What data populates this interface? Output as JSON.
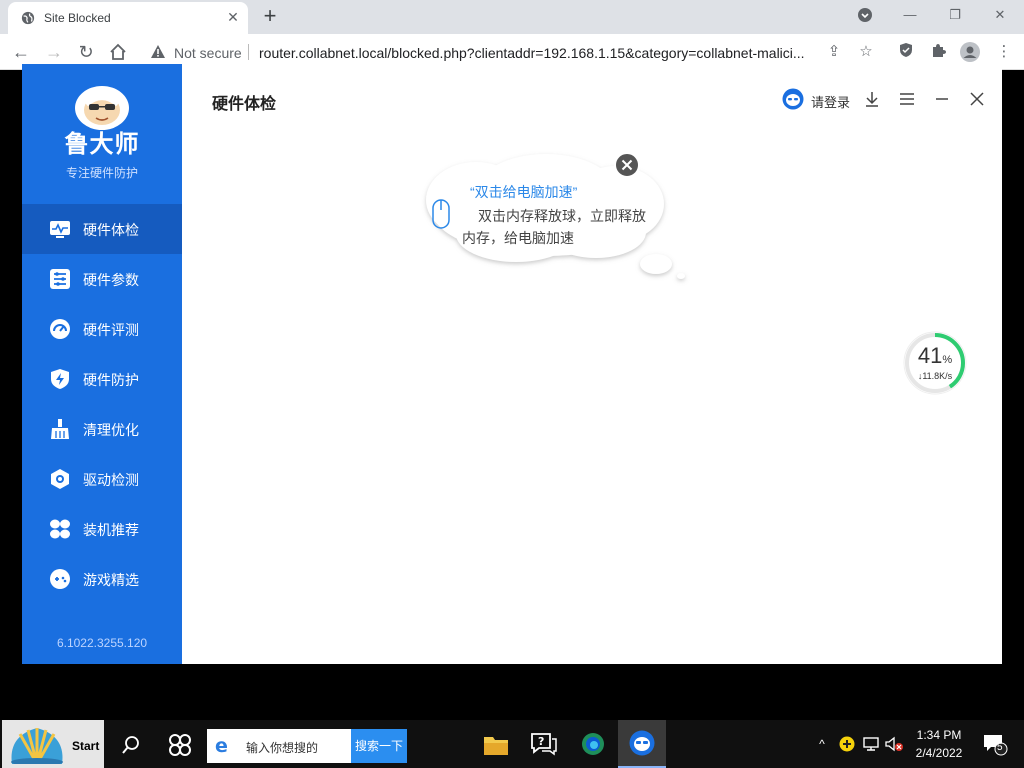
{
  "browser": {
    "tab_title": "Site Blocked",
    "new_tab": "+",
    "security_label": "Not secure",
    "url": "router.collabnet.local/blocked.php?clientaddr=192.168.1.15&category=collabnet-malici..."
  },
  "app": {
    "brand": "鲁大师",
    "slogan": "专注硬件防护",
    "content_title": "硬件体检",
    "login_label": "请登录",
    "version": "6.1022.3255.120",
    "accent_color": "#1a6fe0",
    "menu": [
      {
        "label": "硬件体检",
        "icon": "heartbeat-monitor-icon",
        "active": true
      },
      {
        "label": "硬件参数",
        "icon": "params-list-icon",
        "active": false
      },
      {
        "label": "硬件评测",
        "icon": "speedometer-icon",
        "active": false
      },
      {
        "label": "硬件防护",
        "icon": "lightning-shield-icon",
        "active": false
      },
      {
        "label": "清理优化",
        "icon": "broom-icon",
        "active": false
      },
      {
        "label": "驱动检测",
        "icon": "gear-hex-icon",
        "active": false
      },
      {
        "label": "装机推荐",
        "icon": "fan-icon",
        "active": false
      },
      {
        "label": "游戏精选",
        "icon": "gamepad-icon",
        "active": false
      }
    ],
    "bubble": {
      "title": "“双击给电脑加速”",
      "text": "双击内存释放球，立即释放内存，给电脑加速"
    },
    "speed_ball": {
      "percent": "41",
      "percent_unit": "%",
      "speed": "↓11.8K/s",
      "ring_fraction": 0.41,
      "ring_color": "#2ecc71"
    }
  },
  "taskbar": {
    "start_label": "Start",
    "search_placeholder": "输入你想搜的",
    "search_button": "搜索一下",
    "time": "1:34 PM",
    "date": "2/4/2022",
    "notification_count": "5"
  }
}
